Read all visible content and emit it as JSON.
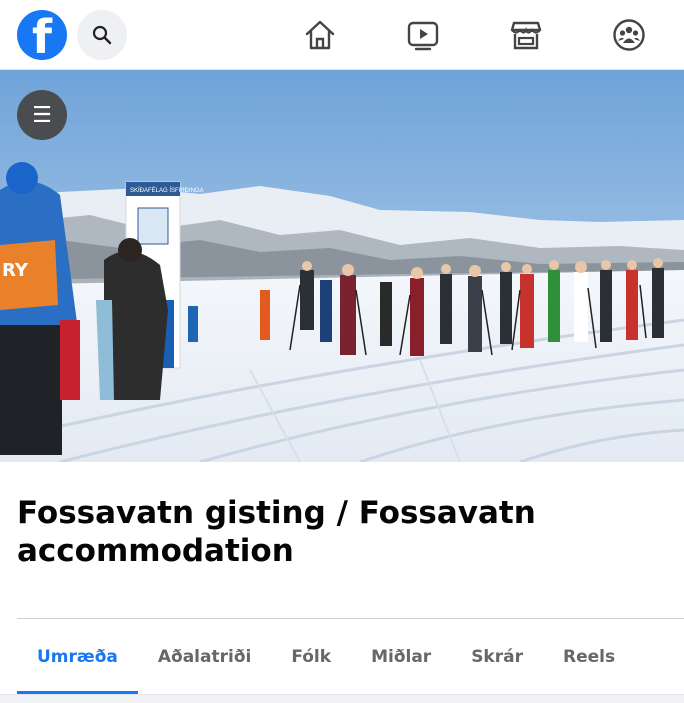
{
  "app": {
    "logo": "f",
    "accent": "#1877f2"
  },
  "topbar": {
    "icons": [
      "search-icon",
      "home-icon",
      "watch-icon",
      "marketplace-icon",
      "groups-icon"
    ]
  },
  "cover": {
    "menu_icon": "☰",
    "sign_text": "SKÍÐAFÉLAG ÍSFIRÐINGA",
    "bib_text": "RY"
  },
  "group": {
    "title": "Fossavatn gisting / Fossavatn accommodation"
  },
  "tabs": [
    {
      "label": "Umræða",
      "active": true
    },
    {
      "label": "Aðalatriði",
      "active": false
    },
    {
      "label": "Fólk",
      "active": false
    },
    {
      "label": "Miðlar",
      "active": false
    },
    {
      "label": "Skrár",
      "active": false
    },
    {
      "label": "Reels",
      "active": false
    }
  ]
}
